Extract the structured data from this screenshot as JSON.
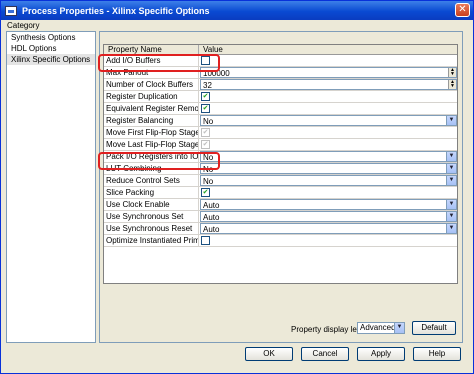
{
  "window": {
    "title": "Process Properties - Xilinx Specific Options"
  },
  "category": {
    "label": "Category",
    "items": [
      "Synthesis Options",
      "HDL Options",
      "Xilinx Specific Options"
    ]
  },
  "grid": {
    "headers": {
      "name": "Property Name",
      "value": "Value"
    },
    "rows": [
      {
        "name": "Add I/O Buffers",
        "type": "checkbox",
        "checked": false
      },
      {
        "name": "Max Fanout",
        "type": "spin",
        "value": "100000"
      },
      {
        "name": "Number of Clock Buffers",
        "type": "spin",
        "value": "32"
      },
      {
        "name": "Register Duplication",
        "type": "checkbox",
        "checked": true
      },
      {
        "name": "Equivalent Register Removal",
        "type": "checkbox",
        "checked": true
      },
      {
        "name": "Register Balancing",
        "type": "select",
        "value": "No"
      },
      {
        "name": "Move First Flip-Flop Stage",
        "type": "checkbox",
        "checked": true,
        "disabled": true
      },
      {
        "name": "Move Last Flip-Flop Stage",
        "type": "checkbox",
        "checked": true,
        "disabled": true
      },
      {
        "name": "Pack I/O Registers into IOBs",
        "type": "select",
        "value": "No"
      },
      {
        "name": "LUT Combining",
        "type": "select",
        "value": "No"
      },
      {
        "name": "Reduce Control Sets",
        "type": "select",
        "value": "No"
      },
      {
        "name": "Slice Packing",
        "type": "checkbox",
        "checked": true
      },
      {
        "name": "Use Clock Enable",
        "type": "select",
        "value": "Auto"
      },
      {
        "name": "Use Synchronous Set",
        "type": "select",
        "value": "Auto"
      },
      {
        "name": "Use Synchronous Reset",
        "type": "select",
        "value": "Auto"
      },
      {
        "name": "Optimize Instantiated Primitives",
        "type": "checkbox",
        "checked": false
      }
    ]
  },
  "display_level": {
    "label": "Property display level:",
    "value": "Advanced"
  },
  "buttons": {
    "default": "Default",
    "ok": "OK",
    "cancel": "Cancel",
    "apply": "Apply",
    "help": "Help"
  },
  "colors": {
    "highlight": "#e02020",
    "titlebar": "#0a4ad2",
    "check": "#21a121"
  }
}
